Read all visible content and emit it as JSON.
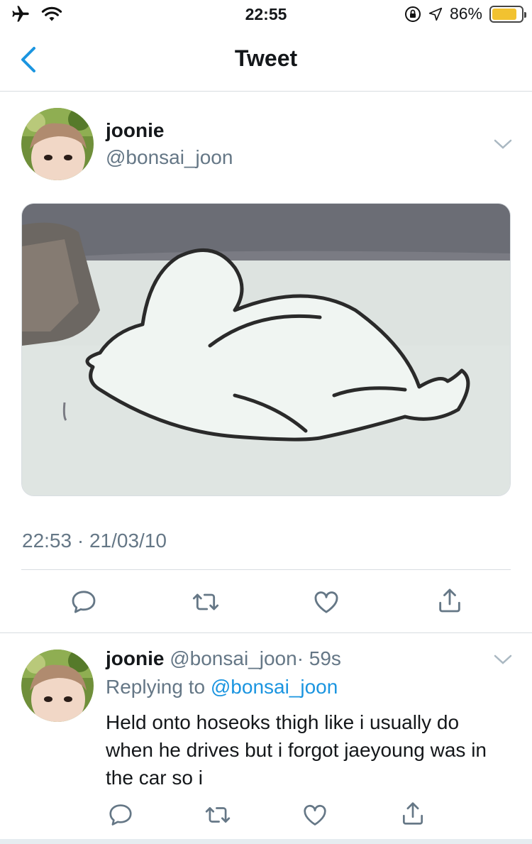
{
  "status_bar": {
    "time": "22:55",
    "battery_percent": "86%",
    "battery_level": 0.86,
    "icons": [
      "airplane-icon",
      "wifi-icon",
      "orientation-lock-icon",
      "location-icon",
      "battery-icon"
    ]
  },
  "nav": {
    "title": "Tweet",
    "back_icon": "chevron-left-icon"
  },
  "tweet": {
    "name": "joonie",
    "handle": "@bonsai_joon",
    "timestamp": "22:53 · 21/03/10",
    "actions": [
      "reply-icon",
      "retweet-icon",
      "like-icon",
      "share-icon"
    ]
  },
  "reply": {
    "name": "joonie",
    "handle": "@bonsai_joon",
    "age": "· 59s",
    "replying_prefix": "Replying to",
    "replying_to": "@bonsai_joon",
    "text": "Held onto hoseoks thigh like i usually do when he drives but i forgot jaeyoung was in the car so i",
    "actions": [
      "reply-icon",
      "retweet-icon",
      "like-icon",
      "share-icon"
    ]
  },
  "colors": {
    "accent": "#1b95e0",
    "secondary_text": "#657786",
    "divider": "#d8dde1",
    "battery": "#f2c230"
  }
}
